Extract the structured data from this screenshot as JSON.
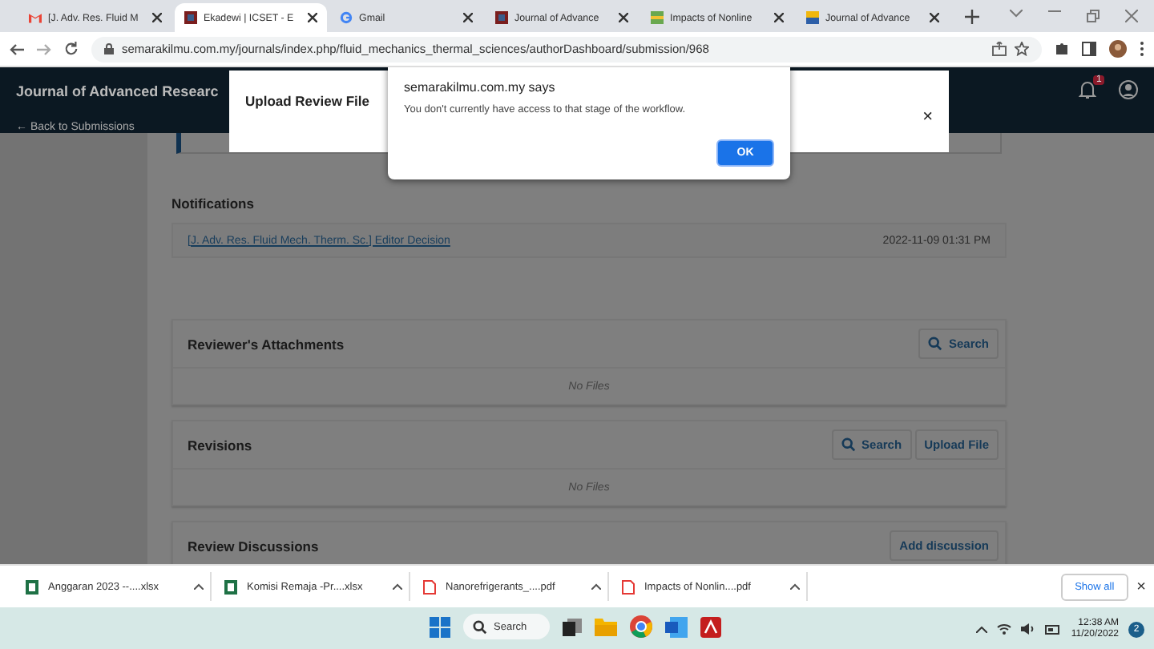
{
  "browser": {
    "tabs": [
      {
        "title": "[J. Adv. Res. Fluid M",
        "kind": "gmail",
        "selected": false
      },
      {
        "title": "Ekadewi | ICSET - E",
        "kind": "site-red",
        "selected": true
      },
      {
        "title": "Gmail",
        "kind": "google",
        "selected": false
      },
      {
        "title": "Journal of Advance",
        "kind": "site-red",
        "selected": false
      },
      {
        "title": "Impacts of Nonline",
        "kind": "site-green",
        "selected": false
      },
      {
        "title": "Journal of Advance",
        "kind": "site-yellow",
        "selected": false
      }
    ],
    "url": "semarakilmu.com.my/journals/index.php/fluid_mechanics_thermal_sciences/authorDashboard/submission/968"
  },
  "header": {
    "journal": "Journal of Advanced Researc",
    "back": "← Back to Submissions",
    "notification_count": "1"
  },
  "modal": {
    "title": "Upload Review File",
    "close": "×"
  },
  "alert": {
    "origin": "semarakilmu.com.my says",
    "message": "You don't currently have access to that stage of the workflow.",
    "ok": "OK"
  },
  "notifications": {
    "heading": "Notifications",
    "items": [
      {
        "link": "[J. Adv. Res. Fluid Mech. Therm. Sc.] Editor Decision",
        "date": "2022-11-09 01:31 PM"
      }
    ]
  },
  "panels": [
    {
      "title": "Reviewer's Attachments",
      "buttons": [
        {
          "label": "Search",
          "kind": "search"
        }
      ],
      "empty": "No Files"
    },
    {
      "title": "Revisions",
      "buttons": [
        {
          "label": "Search",
          "kind": "search"
        },
        {
          "label": "Upload File",
          "kind": "plain"
        }
      ],
      "empty": "No Files"
    },
    {
      "title": "Review Discussions",
      "buttons": [
        {
          "label": "Add discussion",
          "kind": "plain"
        }
      ]
    }
  ],
  "downloads": {
    "items": [
      {
        "name": "Anggaran 2023 --....xlsx",
        "kind": "excel"
      },
      {
        "name": "Komisi Remaja -Pr....xlsx",
        "kind": "excel"
      },
      {
        "name": "Nanorefrigerants_....pdf",
        "kind": "pdf"
      },
      {
        "name": "Impacts of Nonlin....pdf",
        "kind": "pdf"
      }
    ],
    "show_all": "Show all",
    "close": "×"
  },
  "taskbar": {
    "search": "Search",
    "time": "12:38 AM",
    "date": "11/20/2022",
    "badge": "2"
  }
}
